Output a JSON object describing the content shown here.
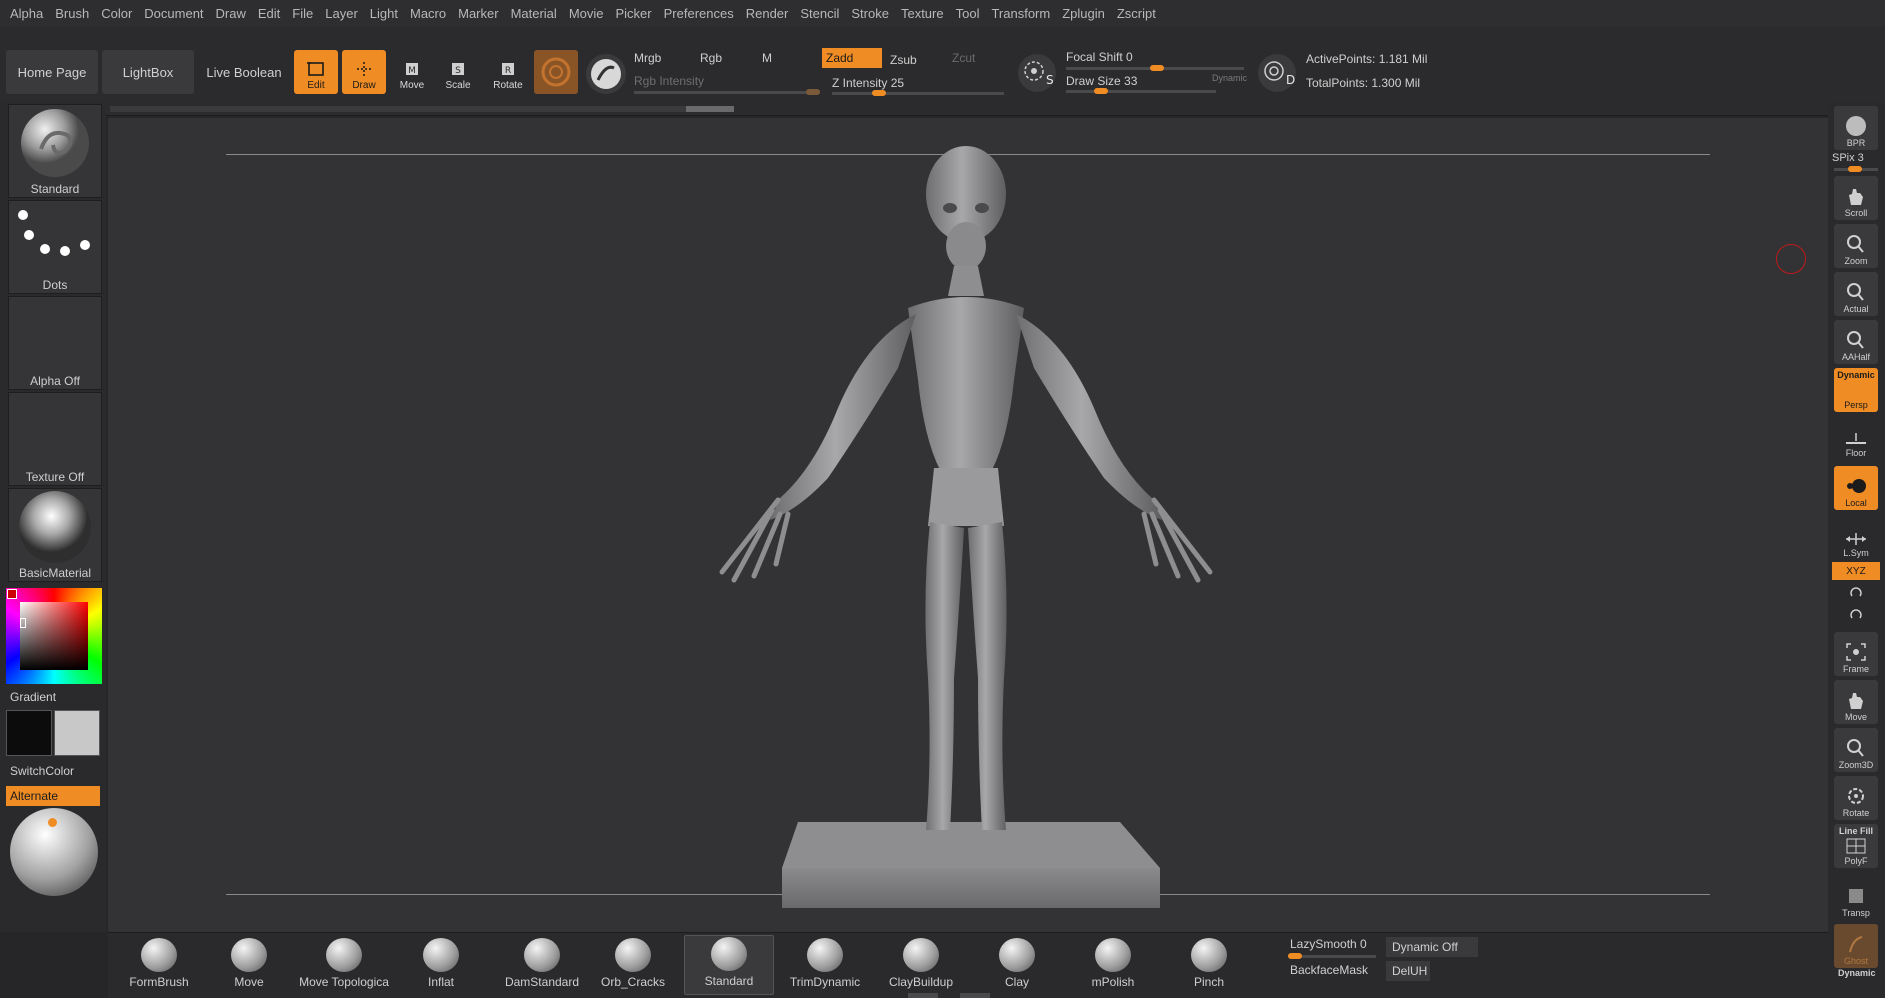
{
  "menu": [
    "Alpha",
    "Brush",
    "Color",
    "Document",
    "Draw",
    "Edit",
    "File",
    "Layer",
    "Light",
    "Macro",
    "Marker",
    "Material",
    "Movie",
    "Picker",
    "Preferences",
    "Render",
    "Stencil",
    "Stroke",
    "Texture",
    "Tool",
    "Transform",
    "Zplugin",
    "Zscript"
  ],
  "toolbar": {
    "home_page": "Home Page",
    "lightbox": "LightBox",
    "live_boolean": "Live Boolean",
    "edit": "Edit",
    "draw": "Draw",
    "move": "Move",
    "scale": "Scale",
    "rotate": "Rotate",
    "mrgb": "Mrgb",
    "rgb": "Rgb",
    "m": "M",
    "zadd": "Zadd",
    "zsub": "Zsub",
    "zcut": "Zcut",
    "rgb_intensity": "Rgb Intensity",
    "z_intensity_label": "Z Intensity",
    "z_intensity_value": "25",
    "z_intensity_fraction": 0.25,
    "focal_shift_label": "Focal Shift",
    "focal_shift_value": "0",
    "draw_size_label": "Draw Size",
    "draw_size_value": "33",
    "dynamic": "Dynamic",
    "active_points": "ActivePoints: 1.181 Mil",
    "total_points": "TotalPoints: 1.300 Mil",
    "s_letter": "S",
    "d_letter": "D"
  },
  "left": {
    "brush": "Standard",
    "stroke": "Dots",
    "alpha": "Alpha Off",
    "texture": "Texture Off",
    "material": "BasicMaterial",
    "gradient": "Gradient",
    "switch_color": "SwitchColor",
    "alternate": "Alternate",
    "main_color": "#0c0c0c",
    "secondary_color": "#c8c8c8"
  },
  "right": {
    "bpr": "BPR",
    "spix": "SPix 3",
    "scroll": "Scroll",
    "zoom": "Zoom",
    "actual": "Actual",
    "aahalf": "AAHalf",
    "dynamic": "Dynamic",
    "persp": "Persp",
    "floor": "Floor",
    "local": "Local",
    "lsym": "L.Sym",
    "xyz": "XYZ",
    "frame": "Frame",
    "move": "Move",
    "zoom3d": "Zoom3D",
    "rotate": "Rotate",
    "line_fill": "Line Fill",
    "polyf": "PolyF",
    "transp": "Transp",
    "ghost": "Ghost",
    "dynamic2": "Dynamic"
  },
  "bottom": {
    "brushes": [
      "FormBrush",
      "Move",
      "Move Topologica",
      "Inflat",
      "DamStandard",
      "Orb_Cracks",
      "Standard",
      "TrimDynamic",
      "ClayBuildup",
      "Clay",
      "mPolish",
      "Pinch"
    ],
    "active_brush_index": 6,
    "lazy_smooth": "LazySmooth 0",
    "dynamic_off": "Dynamic Off",
    "backface_mask": "BackfaceMask",
    "deluh": "DelUH"
  },
  "accent": "#f08c24"
}
